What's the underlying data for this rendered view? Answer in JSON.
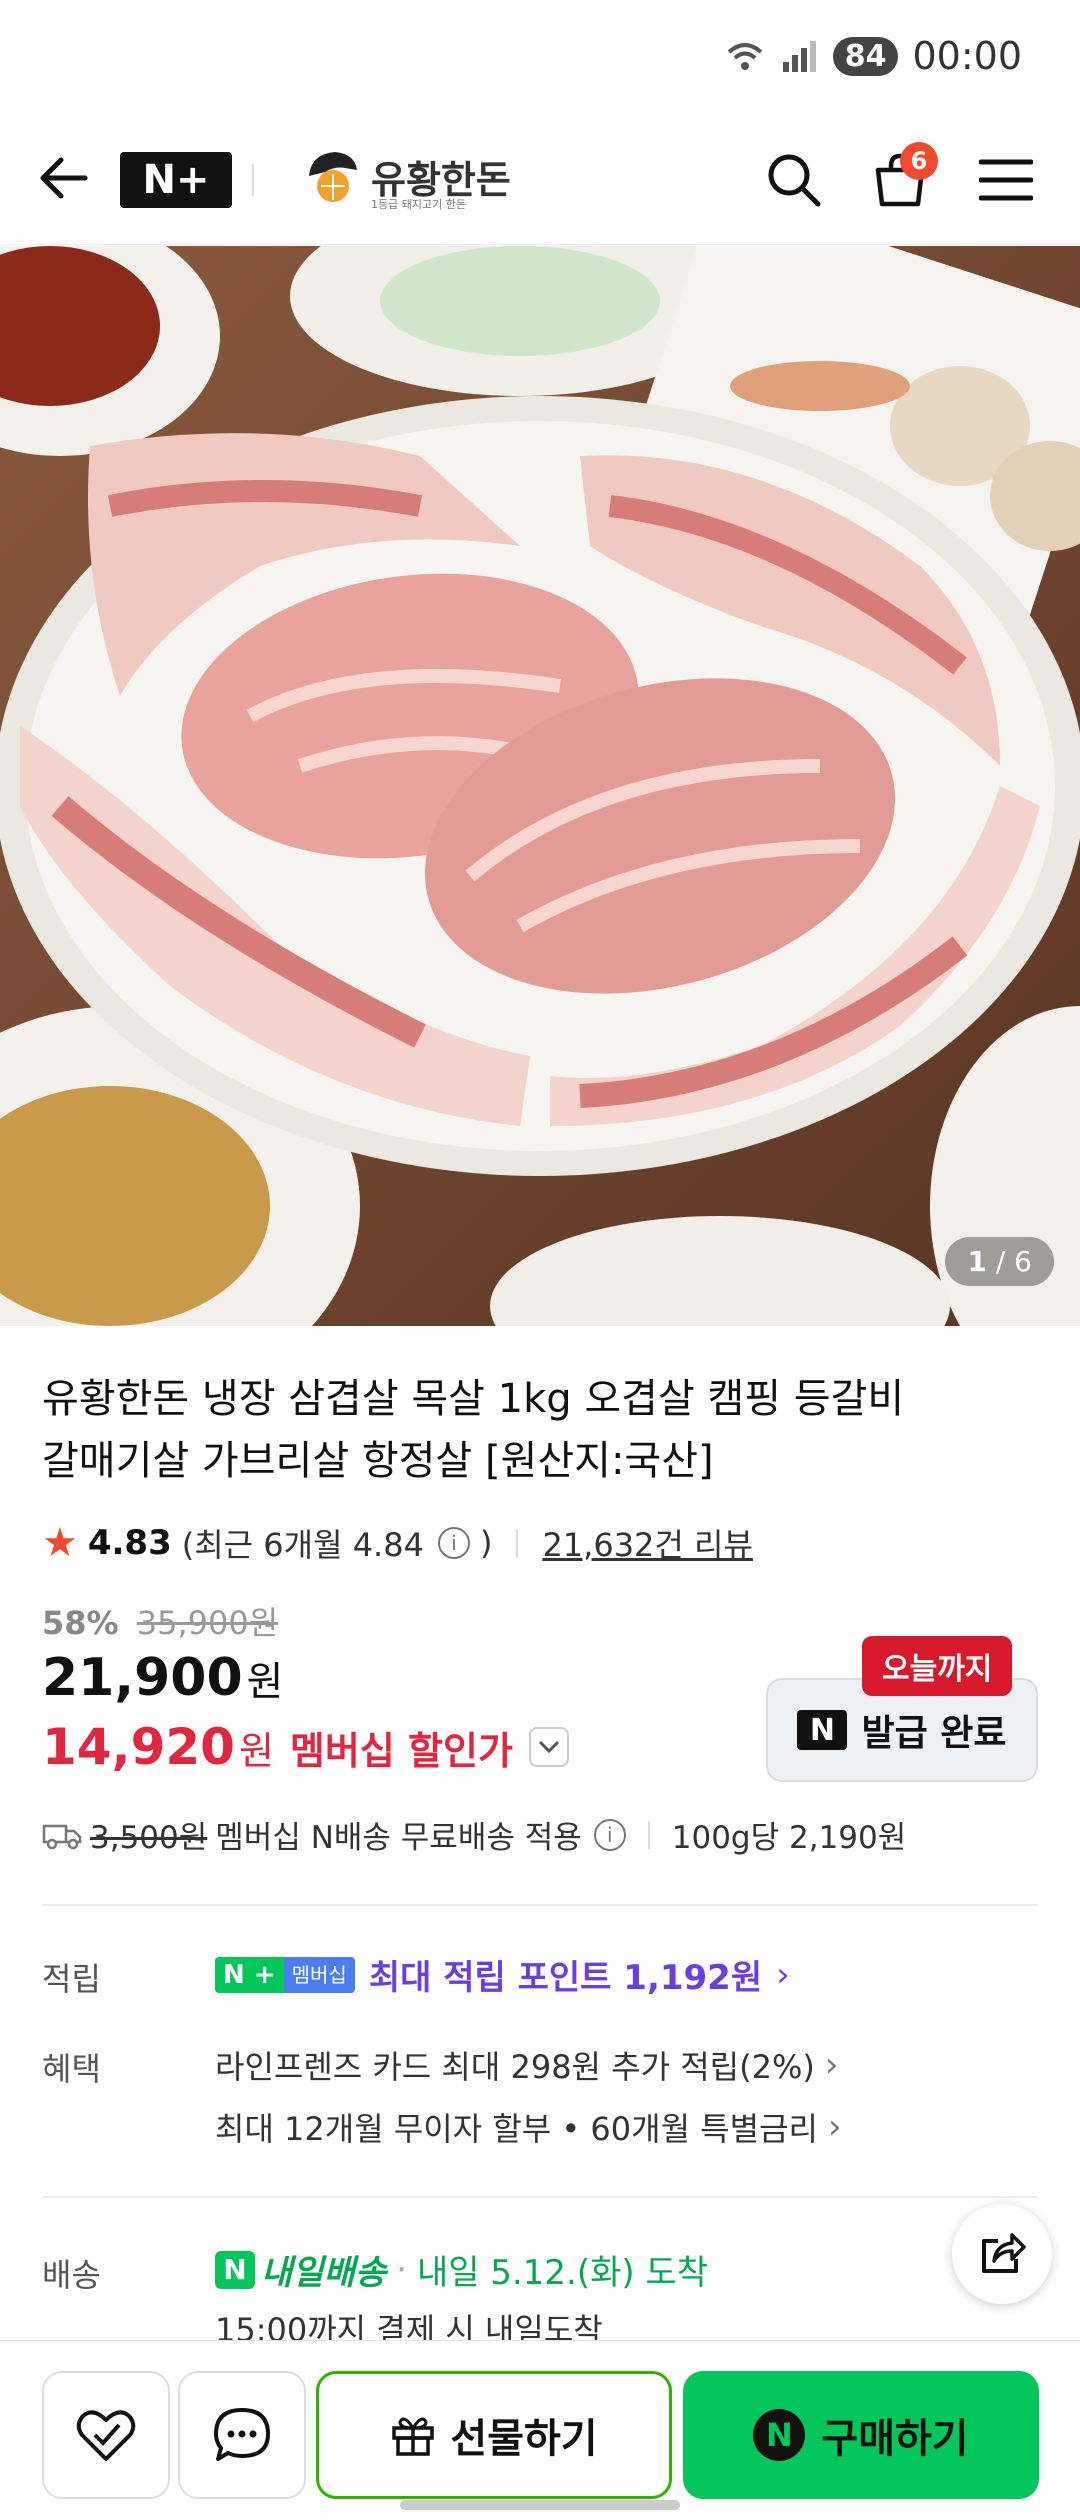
{
  "status_bar": {
    "battery": "84",
    "time": "00:00"
  },
  "header": {
    "nplus_logo": "N+",
    "brand_name": "유황한돈",
    "brand_sub": "1등급 돼지고기 한돈",
    "cart_count": "6"
  },
  "image": {
    "current": "1",
    "total": "/ 6"
  },
  "product": {
    "title_line1": "유황한돈 냉장 삼겹살 목살 1kg 오겹살 캠핑 등갈비",
    "title_line2": "갈매기살 가브리살 항정살 [원산지:국산]",
    "rating": "4.83",
    "rating_recent": "(최근 6개월 4.84",
    "rating_close": ")",
    "reviews": "21,632건 리뷰",
    "discount_rate": "58%",
    "original_price": "35,900원",
    "price": "21,900",
    "price_unit": "원",
    "member_price": "14,920",
    "member_unit": "원",
    "member_label": "멤버십 할인가"
  },
  "coupon": {
    "tag": "오늘까지",
    "n_logo": "N",
    "label": "발급 완료"
  },
  "shipping": {
    "fee": "3,500원",
    "text": "멤버십 N배송 무료배송 적용",
    "unit_price": "100g당 2,190원"
  },
  "points": {
    "label": "적립",
    "badge_n": "N +",
    "badge_member": "멤버십",
    "text": "최대 적립 포인트 1,192원"
  },
  "benefits": {
    "label": "혜택",
    "line1": "라인프렌즈 카드 최대 298원 추가 적립(2%)",
    "line2": "최대 12개월 무이자 할부 • 60개월 특별금리"
  },
  "delivery": {
    "label": "배송",
    "badge": "내일배송",
    "badge_n": "N",
    "date": "내일 5.12.(화) 도착",
    "sub": "15:00까지 결제 시 내일도착"
  },
  "bottom_bar": {
    "gift": "선물하기",
    "buy_n": "N",
    "buy": "구매하기"
  },
  "colors": {
    "accent_green": "#03c75a",
    "member_red": "#e2263f",
    "points_purple": "#6c3ee0",
    "cart_badge": "#f0492b"
  }
}
